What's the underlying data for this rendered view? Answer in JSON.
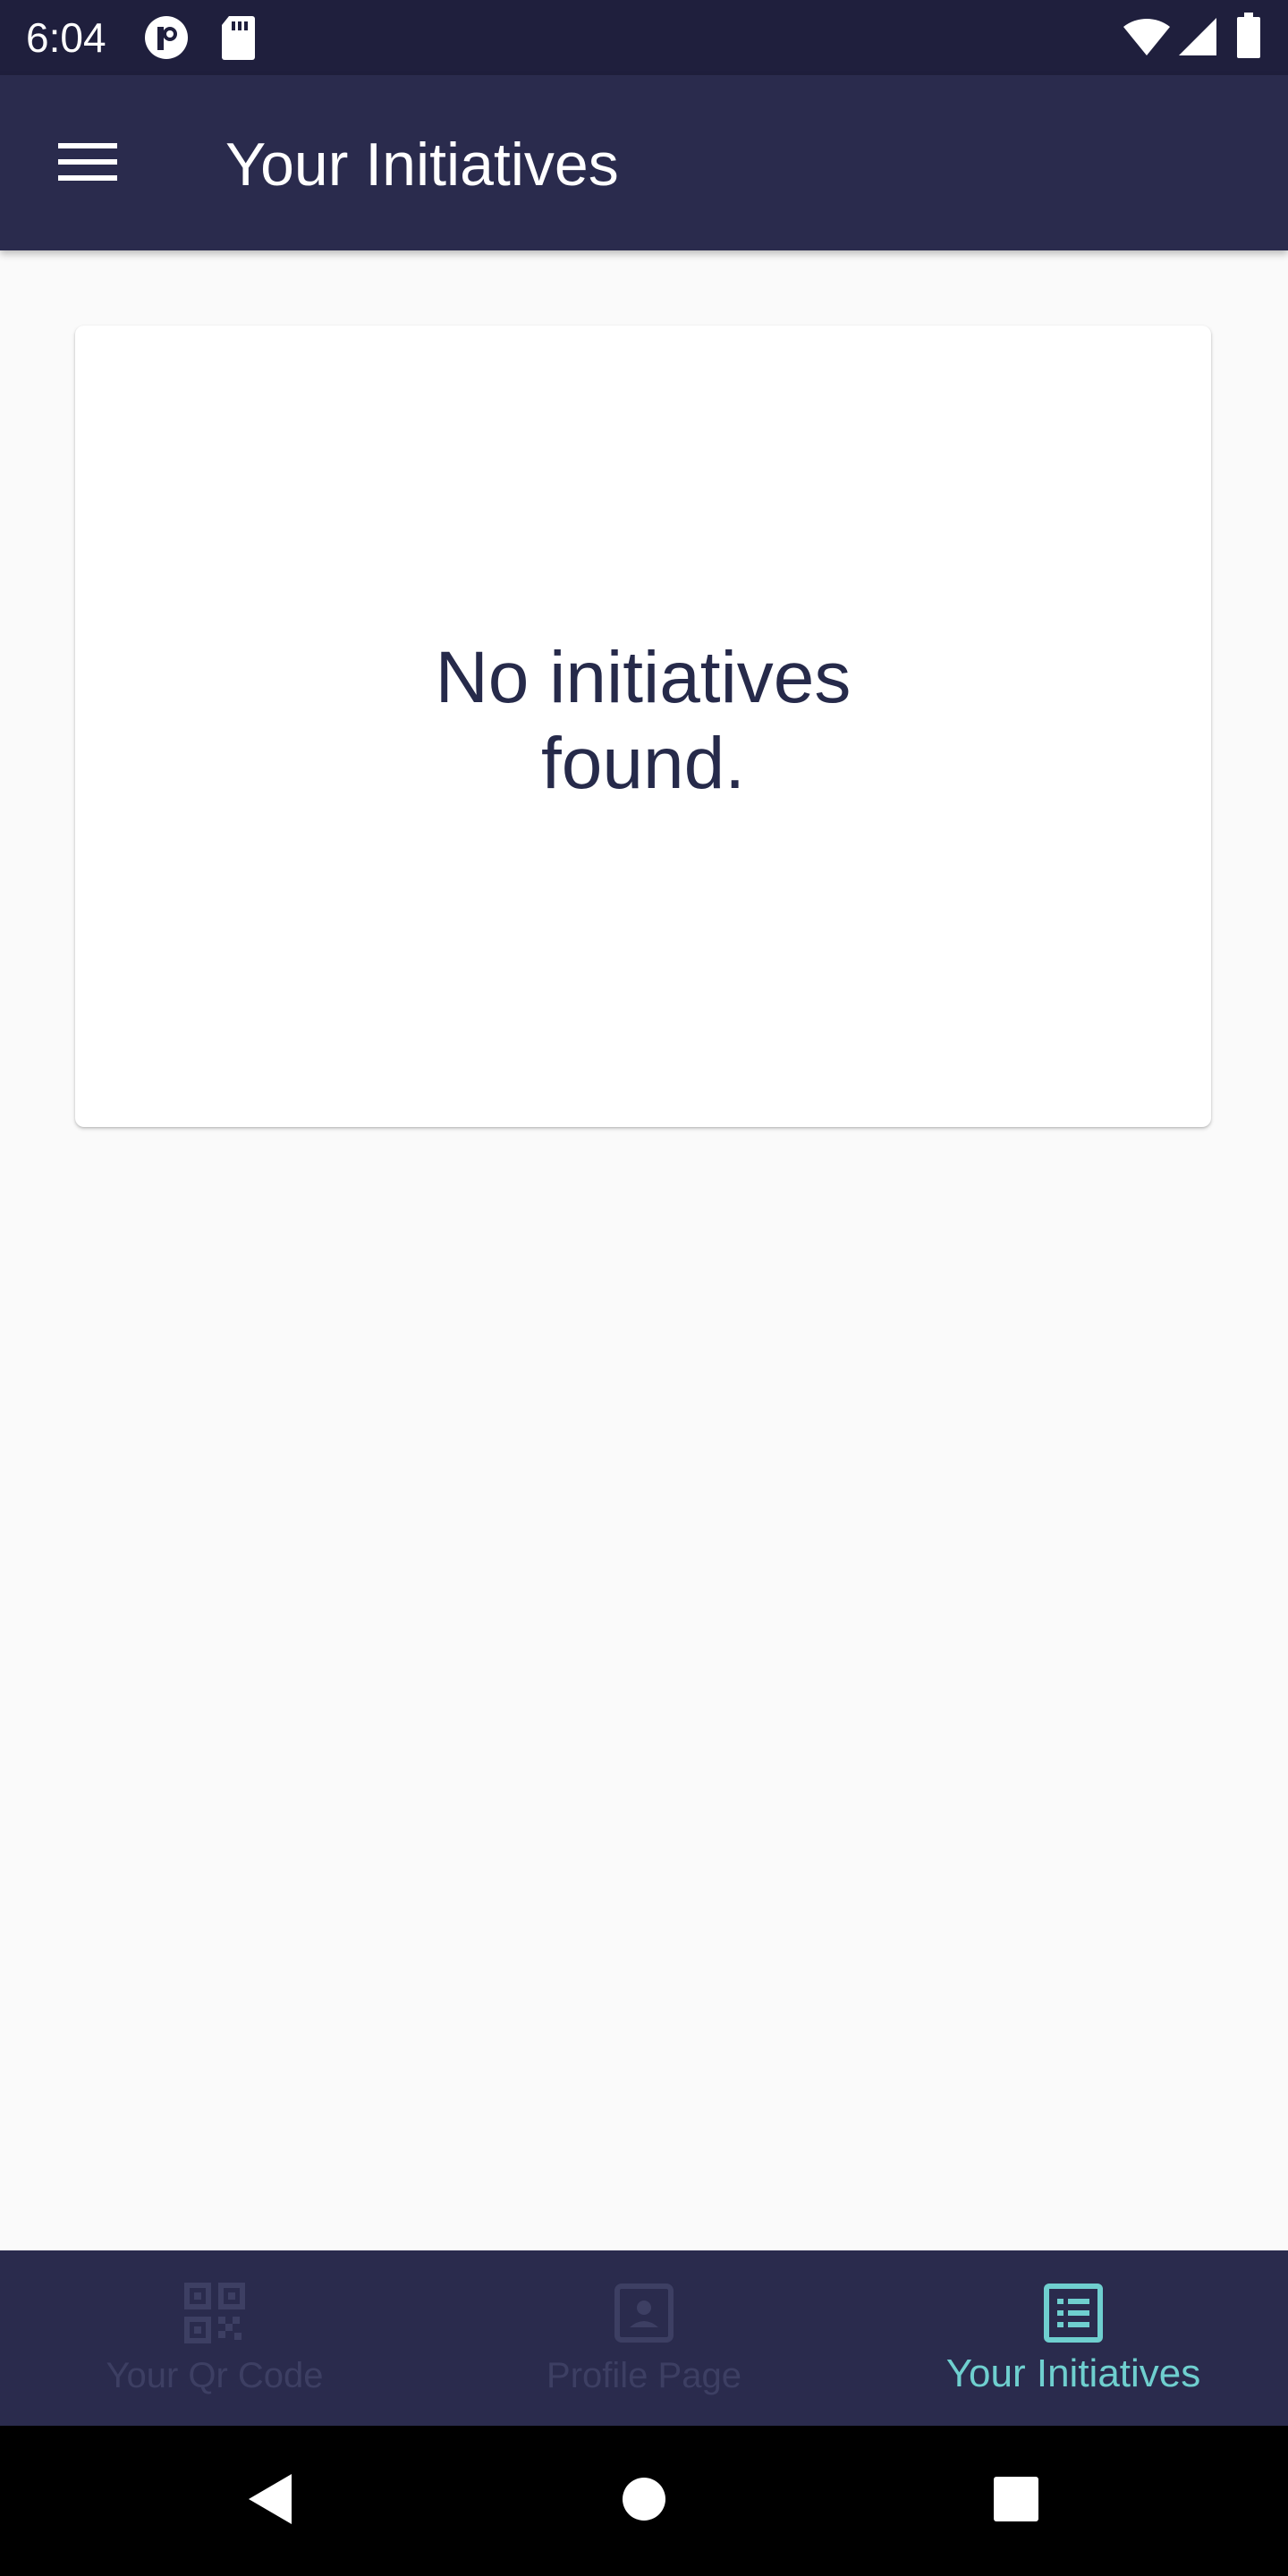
{
  "status_bar": {
    "time": "6:04",
    "icons": [
      "notification-app-icon",
      "sd-card-icon",
      "wifi-icon",
      "cell-signal-icon",
      "battery-icon"
    ]
  },
  "app_bar": {
    "menu_icon": "hamburger-menu-icon",
    "title": "Your Initiatives"
  },
  "main": {
    "empty_message": "No initiatives found."
  },
  "bottom_nav": {
    "items": [
      {
        "label": "Your Qr Code",
        "icon": "qr-code-icon",
        "active": false
      },
      {
        "label": "Profile Page",
        "icon": "profile-portrait-icon",
        "active": false
      },
      {
        "label": "Your Initiatives",
        "icon": "list-icon",
        "active": true
      }
    ]
  },
  "system_nav": {
    "buttons": [
      "back-icon",
      "home-icon",
      "recents-icon"
    ]
  },
  "colors": {
    "status_bar_bg": "#1f1f3d",
    "app_bar_bg": "#2a2b4d",
    "page_bg": "#fafafa",
    "card_bg": "#ffffff",
    "text_dark": "#262a4a",
    "nav_inactive": "#3d3f63",
    "nav_active": "#6fcfcf"
  }
}
